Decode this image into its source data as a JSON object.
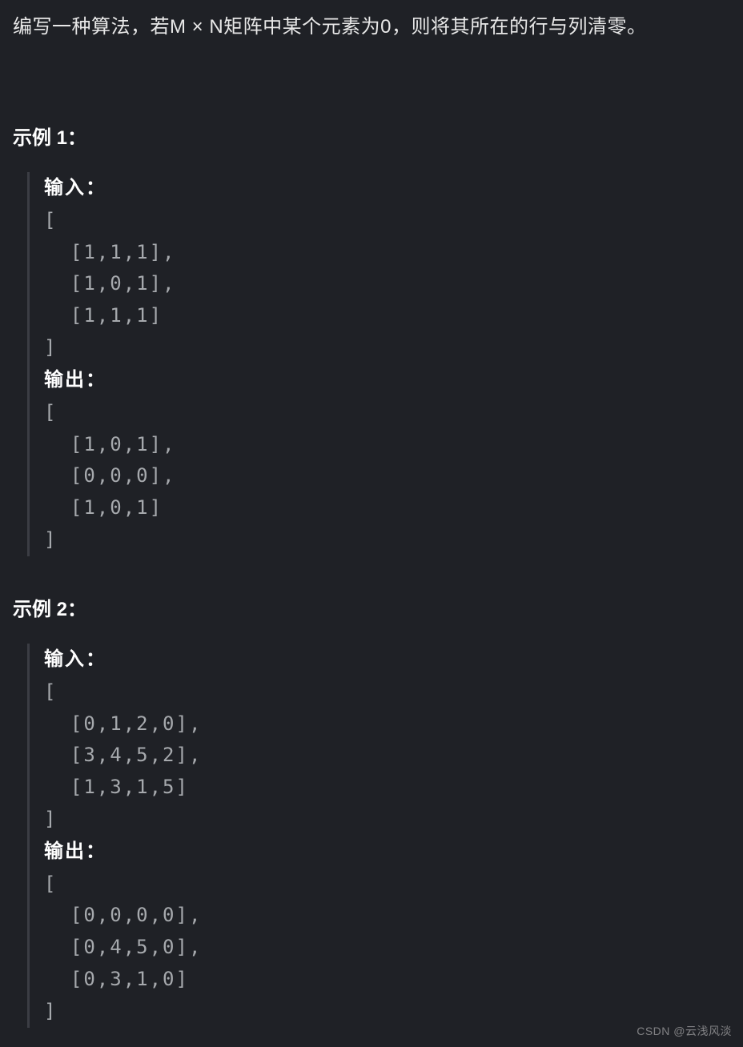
{
  "description": "编写一种算法，若M × N矩阵中某个元素为0，则将其所在的行与列清零。",
  "examples": [
    {
      "heading": "示例 1：",
      "input_label": "输入：",
      "output_label": "输出：",
      "input_matrix": [
        [
          1,
          1,
          1
        ],
        [
          1,
          0,
          1
        ],
        [
          1,
          1,
          1
        ]
      ],
      "output_matrix": [
        [
          1,
          0,
          1
        ],
        [
          0,
          0,
          0
        ],
        [
          1,
          0,
          1
        ]
      ],
      "input_lines": [
        "[",
        "  [1,1,1],",
        "  [1,0,1],",
        "  [1,1,1]",
        "]"
      ],
      "output_lines": [
        "[",
        "  [1,0,1],",
        "  [0,0,0],",
        "  [1,0,1]",
        "]"
      ]
    },
    {
      "heading": "示例 2：",
      "input_label": "输入：",
      "output_label": "输出：",
      "input_matrix": [
        [
          0,
          1,
          2,
          0
        ],
        [
          3,
          4,
          5,
          2
        ],
        [
          1,
          3,
          1,
          5
        ]
      ],
      "output_matrix": [
        [
          0,
          0,
          0,
          0
        ],
        [
          0,
          4,
          5,
          0
        ],
        [
          0,
          3,
          1,
          0
        ]
      ],
      "input_lines": [
        "[",
        "  [0,1,2,0],",
        "  [3,4,5,2],",
        "  [1,3,1,5]",
        "]"
      ],
      "output_lines": [
        "[",
        "  [0,0,0,0],",
        "  [0,4,5,0],",
        "  [0,3,1,0]",
        "]"
      ]
    }
  ],
  "watermark": "CSDN @云浅风淡"
}
